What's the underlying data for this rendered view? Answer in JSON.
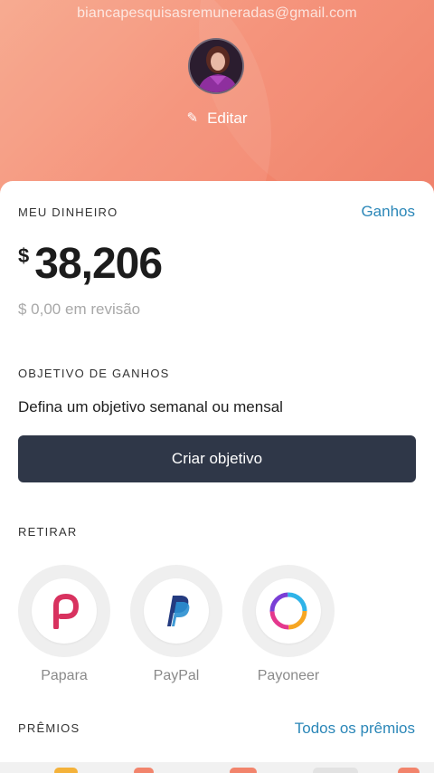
{
  "header": {
    "email": "biancapesquisasremuneradas@gmail.com",
    "edit_label": "Editar"
  },
  "money": {
    "section_title": "MEU DINHEIRO",
    "earnings_link": "Ganhos",
    "currency": "$",
    "amount": "38,206",
    "review": "$ 0,00 em revisão"
  },
  "goal": {
    "section_title": "OBJETIVO DE GANHOS",
    "description": "Defina um objetivo semanal ou mensal",
    "button_label": "Criar objetivo"
  },
  "withdraw": {
    "section_title": "RETIRAR",
    "methods": [
      {
        "label": "Papara",
        "icon": "papara-icon"
      },
      {
        "label": "PayPal",
        "icon": "paypal-icon"
      },
      {
        "label": "Payoneer",
        "icon": "payoneer-icon"
      }
    ]
  },
  "prizes": {
    "section_title": "PRÊMIOS",
    "all_link": "Todos os prêmios"
  },
  "colors": {
    "header_accent": "#f58e74",
    "link": "#2b87b8",
    "button_bg": "#2f3748"
  }
}
